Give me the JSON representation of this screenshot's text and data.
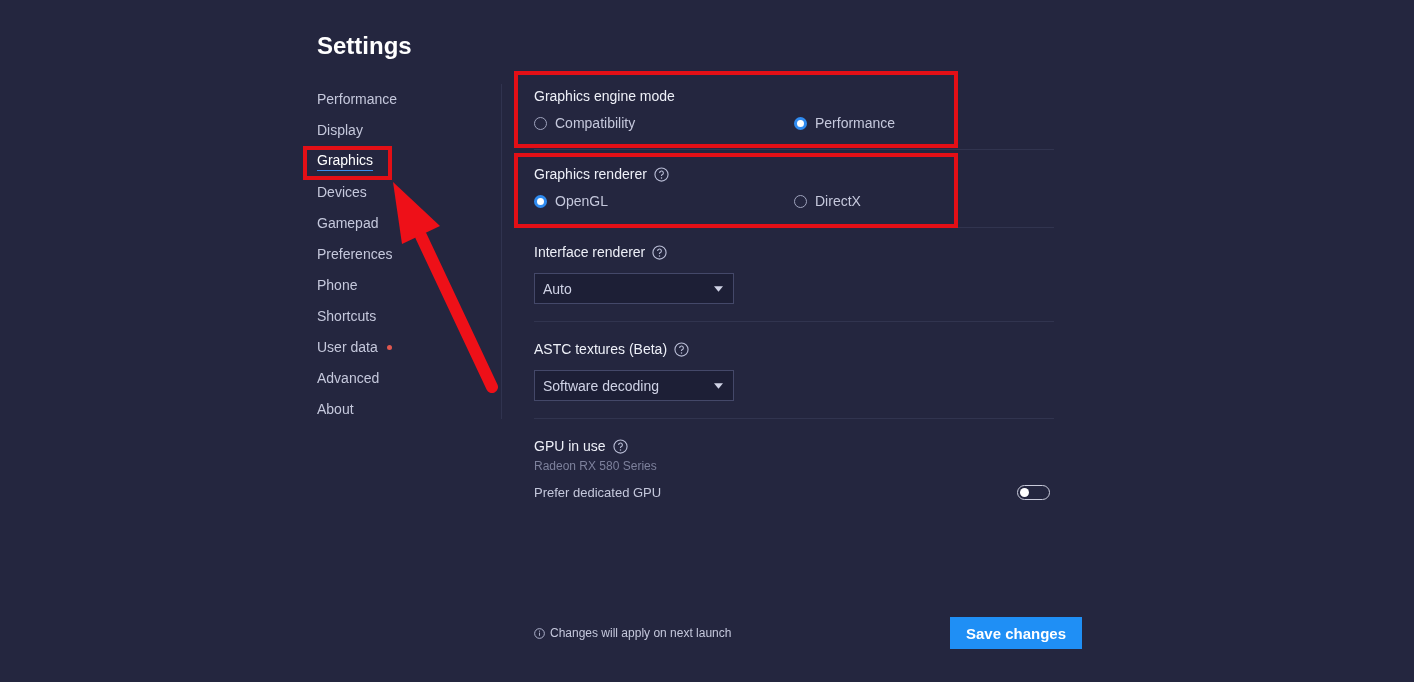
{
  "title": "Settings",
  "sidebar": {
    "items": [
      {
        "label": "Performance",
        "selected": false,
        "badge": false
      },
      {
        "label": "Display",
        "selected": false,
        "badge": false
      },
      {
        "label": "Graphics",
        "selected": true,
        "badge": false
      },
      {
        "label": "Devices",
        "selected": false,
        "badge": false
      },
      {
        "label": "Gamepad",
        "selected": false,
        "badge": false
      },
      {
        "label": "Preferences",
        "selected": false,
        "badge": false
      },
      {
        "label": "Phone",
        "selected": false,
        "badge": false
      },
      {
        "label": "Shortcuts",
        "selected": false,
        "badge": false
      },
      {
        "label": "User data",
        "selected": false,
        "badge": true
      },
      {
        "label": "Advanced",
        "selected": false,
        "badge": false
      },
      {
        "label": "About",
        "selected": false,
        "badge": false
      }
    ]
  },
  "sections": [
    {
      "kind": "radio",
      "title": "Graphics engine mode",
      "help": false,
      "options": [
        {
          "label": "Compatibility",
          "selected": false
        },
        {
          "label": "Performance",
          "selected": true
        }
      ]
    },
    {
      "kind": "radio",
      "title": "Graphics renderer",
      "help": true,
      "options": [
        {
          "label": "OpenGL",
          "selected": true
        },
        {
          "label": "DirectX",
          "selected": false
        }
      ]
    },
    {
      "kind": "select",
      "title": "Interface renderer",
      "help": true,
      "value": "Auto"
    },
    {
      "kind": "select",
      "title": "ASTC textures (Beta)",
      "help": true,
      "value": "Software decoding"
    },
    {
      "kind": "gpu",
      "title": "GPU in use",
      "help": true,
      "value": "Radeon RX 580 Series",
      "toggle": {
        "label": "Prefer dedicated GPU",
        "on": false
      }
    }
  ],
  "footer": {
    "note": "Changes will apply on next launch",
    "button": "Save changes"
  }
}
